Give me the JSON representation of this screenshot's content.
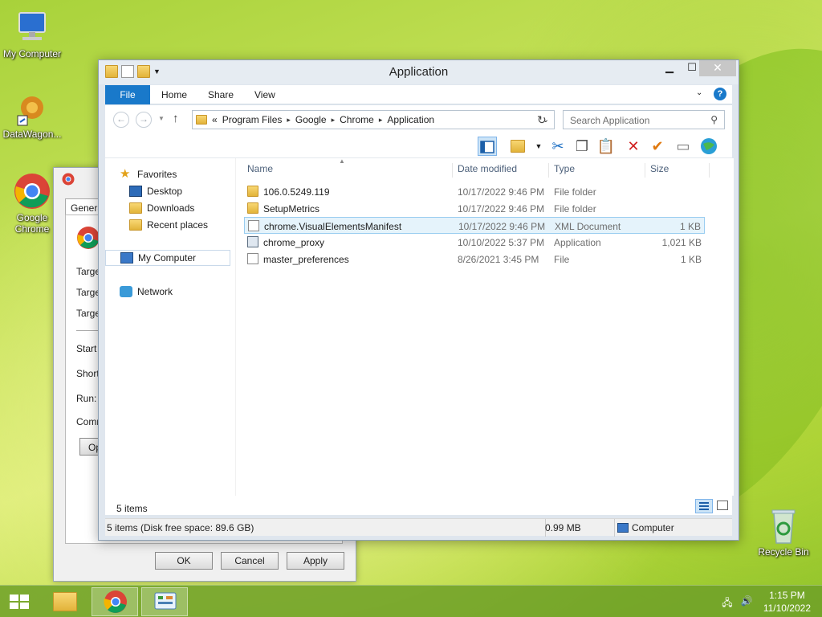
{
  "desktop": {
    "icons": [
      {
        "label": "My Computer"
      },
      {
        "label": "DataWagon..."
      },
      {
        "label": "Google Chrome"
      },
      {
        "label": "Recycle Bin"
      }
    ]
  },
  "props_dialog": {
    "tab": "Genera",
    "labels": [
      "Targe",
      "Targe",
      "Targe",
      "Start i",
      "Shortc",
      "Run:",
      "Comm"
    ],
    "open_button": "Op",
    "ok": "OK",
    "cancel": "Cancel",
    "apply": "Apply"
  },
  "explorer": {
    "title": "Application",
    "ribbon_tabs": {
      "file": "File",
      "home": "Home",
      "share": "Share",
      "view": "View"
    },
    "address": {
      "overflow": "«",
      "crumbs": [
        "Program Files",
        "Google",
        "Chrome",
        "Application"
      ]
    },
    "search_placeholder": "Search Application",
    "nav": {
      "favorites": "Favorites",
      "desktop": "Desktop",
      "downloads": "Downloads",
      "recent": "Recent places",
      "computer": "My Computer",
      "network": "Network"
    },
    "columns": {
      "name": "Name",
      "date": "Date modified",
      "type": "Type",
      "size": "Size"
    },
    "files": [
      {
        "name": "106.0.5249.119",
        "date": "10/17/2022 9:46 PM",
        "type": "File folder",
        "size": ""
      },
      {
        "name": "SetupMetrics",
        "date": "10/17/2022 9:46 PM",
        "type": "File folder",
        "size": ""
      },
      {
        "name": "chrome.VisualElementsManifest",
        "date": "10/17/2022 9:46 PM",
        "type": "XML Document",
        "size": "1 KB"
      },
      {
        "name": "chrome_proxy",
        "date": "10/10/2022 5:37 PM",
        "type": "Application",
        "size": "1,021 KB"
      },
      {
        "name": "master_preferences",
        "date": "8/26/2021 3:45 PM",
        "type": "File",
        "size": "1 KB"
      }
    ],
    "item_count": "5 items",
    "status": {
      "left": "5 items (Disk free space: 89.6 GB)",
      "size": "0.99 MB",
      "location": "Computer"
    }
  },
  "taskbar": {
    "time": "1:15 PM",
    "date": "11/10/2022"
  }
}
